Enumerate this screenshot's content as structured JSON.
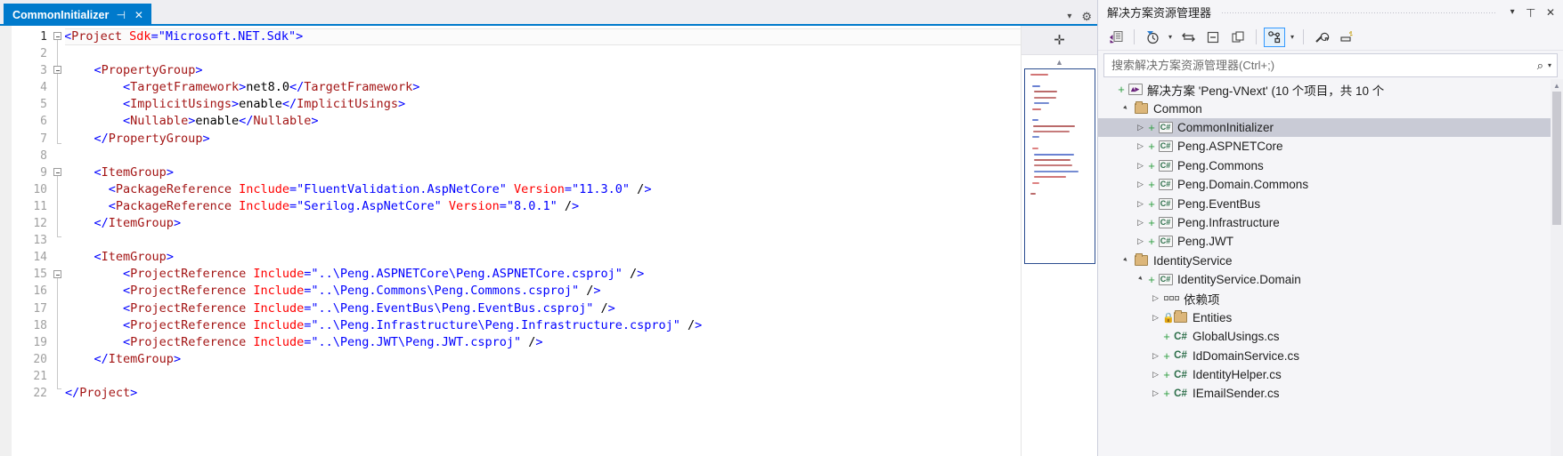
{
  "editor": {
    "tab": {
      "title": "CommonInitializer",
      "pin_icon": "⊣",
      "close_icon": "✕"
    },
    "tab_right": {
      "chevron_icon": "▾",
      "gear_icon": "⚙"
    },
    "minimap": {
      "split_icon": "✛",
      "up_arrow_icon": "▲"
    },
    "line_numbers": [
      "1",
      "2",
      "3",
      "4",
      "5",
      "6",
      "7",
      "8",
      "9",
      "10",
      "11",
      "12",
      "13",
      "14",
      "15",
      "16",
      "17",
      "18",
      "19",
      "20",
      "21",
      "22"
    ],
    "code_lines": [
      "<Project Sdk=\"Microsoft.NET.Sdk\">",
      "",
      "    <PropertyGroup>",
      "        <TargetFramework>net8.0</TargetFramework>",
      "        <ImplicitUsings>enable</ImplicitUsings>",
      "        <Nullable>enable</Nullable>",
      "    </PropertyGroup>",
      "",
      "    <ItemGroup>",
      "      <PackageReference Include=\"FluentValidation.AspNetCore\" Version=\"11.3.0\" />",
      "      <PackageReference Include=\"Serilog.AspNetCore\" Version=\"8.0.1\" />",
      "    </ItemGroup>",
      "",
      "    <ItemGroup>",
      "        <ProjectReference Include=\"..\\Peng.ASPNETCore\\Peng.ASPNETCore.csproj\" />",
      "        <ProjectReference Include=\"..\\Peng.Commons\\Peng.Commons.csproj\" />",
      "        <ProjectReference Include=\"..\\Peng.EventBus\\Peng.EventBus.csproj\" />",
      "        <ProjectReference Include=\"..\\Peng.Infrastructure\\Peng.Infrastructure.csproj\" />",
      "        <ProjectReference Include=\"..\\Peng.JWT\\Peng.JWT.csproj\" />",
      "    </ItemGroup>",
      "",
      "</Project>"
    ],
    "colors": {
      "tab_active_bg": "#007acc",
      "tag": "#a31515",
      "bracket": "#0000ff",
      "attribute": "#ff0000",
      "value": "#0000ff",
      "text": "#000000"
    }
  },
  "solution_explorer": {
    "title": "解决方案资源管理器",
    "header_icons": {
      "chevron_down": "▾",
      "pin": "⊥",
      "close": "✕"
    },
    "toolbar": {
      "code_view_label": "切换视图",
      "pending_changes_label": "挂起的更改筛选器",
      "sync_label": "与活动文档同步",
      "collapse_all_label": "全部折叠",
      "show_all_files_label": "显示所有文件",
      "home_label": "主页",
      "properties_label": "属性",
      "preview_label": "预览选定项",
      "caret_icon": "▾"
    },
    "search": {
      "placeholder": "搜索解决方案资源管理器(Ctrl+;)",
      "value": "",
      "search_icon": "⌕",
      "caret_icon": "▾"
    },
    "tree": [
      {
        "label": "解决方案 'Peng-VNext' (10 个项目，共 10 个",
        "depth": 0,
        "twisty": "none",
        "plus": true,
        "icon": "solution",
        "selected": false
      },
      {
        "label": "Common",
        "depth": 1,
        "twisty": "open",
        "plus": false,
        "icon": "folder",
        "selected": false
      },
      {
        "label": "CommonInitializer",
        "depth": 2,
        "twisty": "closed",
        "plus": true,
        "icon": "csproj",
        "selected": true
      },
      {
        "label": "Peng.ASPNETCore",
        "depth": 2,
        "twisty": "closed",
        "plus": true,
        "icon": "csproj",
        "selected": false
      },
      {
        "label": "Peng.Commons",
        "depth": 2,
        "twisty": "closed",
        "plus": true,
        "icon": "csproj",
        "selected": false
      },
      {
        "label": "Peng.Domain.Commons",
        "depth": 2,
        "twisty": "closed",
        "plus": true,
        "icon": "csproj",
        "selected": false
      },
      {
        "label": "Peng.EventBus",
        "depth": 2,
        "twisty": "closed",
        "plus": true,
        "icon": "csproj",
        "selected": false
      },
      {
        "label": "Peng.Infrastructure",
        "depth": 2,
        "twisty": "closed",
        "plus": true,
        "icon": "csproj",
        "selected": false
      },
      {
        "label": "Peng.JWT",
        "depth": 2,
        "twisty": "closed",
        "plus": true,
        "icon": "csproj",
        "selected": false
      },
      {
        "label": "IdentityService",
        "depth": 1,
        "twisty": "open",
        "plus": false,
        "icon": "folder",
        "selected": false
      },
      {
        "label": "IdentityService.Domain",
        "depth": 2,
        "twisty": "open",
        "plus": true,
        "icon": "csproj",
        "selected": false
      },
      {
        "label": "依赖项",
        "depth": 3,
        "twisty": "closed",
        "plus": false,
        "icon": "dependencies",
        "selected": false
      },
      {
        "label": "Entities",
        "depth": 3,
        "twisty": "closed",
        "plus": false,
        "lock": true,
        "icon": "folder",
        "selected": false
      },
      {
        "label": "GlobalUsings.cs",
        "depth": 3,
        "twisty": "none",
        "plus": true,
        "icon": "cs",
        "selected": false
      },
      {
        "label": "IdDomainService.cs",
        "depth": 3,
        "twisty": "closed",
        "plus": true,
        "icon": "cs",
        "selected": false
      },
      {
        "label": "IdentityHelper.cs",
        "depth": 3,
        "twisty": "closed",
        "plus": true,
        "icon": "cs",
        "selected": false
      },
      {
        "label": "IEmailSender.cs",
        "depth": 3,
        "twisty": "closed",
        "plus": true,
        "icon": "cs",
        "selected": false
      }
    ],
    "scrollbar": {
      "up_icon": "▲",
      "down_icon": "▼"
    }
  }
}
